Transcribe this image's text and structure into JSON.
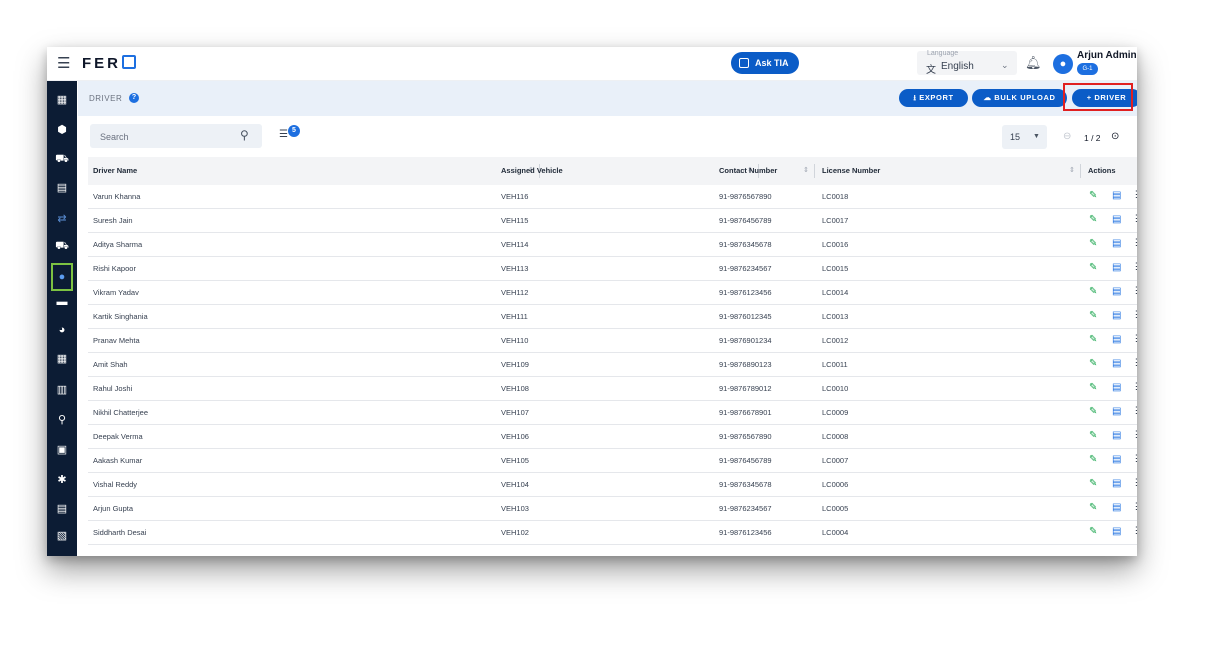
{
  "topbar": {
    "logo_text": "FER",
    "ask_label": "Ask TIA",
    "language_caption": "Language",
    "language_value": "English",
    "user_name": "Arjun Admin",
    "user_badge": "G-1"
  },
  "sidebar": {
    "items": [
      {
        "icon": "dashboard-icon",
        "glyph": "▦"
      },
      {
        "icon": "package-icon",
        "glyph": "⬢"
      },
      {
        "icon": "fleet-icon",
        "glyph": "⛟"
      },
      {
        "icon": "ticket-icon",
        "glyph": "▤"
      },
      {
        "icon": "truck-transfer-icon",
        "glyph": "⇄"
      },
      {
        "icon": "truck-icon",
        "glyph": "⛟"
      },
      {
        "icon": "driver-icon",
        "glyph": "●"
      },
      {
        "icon": "chat-icon",
        "glyph": "▬"
      },
      {
        "icon": "user-voice-icon",
        "glyph": "◕"
      },
      {
        "icon": "sheet-icon",
        "glyph": "▦"
      },
      {
        "icon": "building-icon",
        "glyph": "▥"
      },
      {
        "icon": "route-icon",
        "glyph": "⚲"
      },
      {
        "icon": "inventory-icon",
        "glyph": "▣"
      },
      {
        "icon": "settings-icon",
        "glyph": "✱"
      },
      {
        "icon": "report-icon",
        "glyph": "▤"
      },
      {
        "icon": "archive-icon",
        "glyph": "▧"
      }
    ]
  },
  "header": {
    "title": "DRIVER",
    "export_label": "⭳ EXPORT",
    "bulk_upload_label": "☁ BULK UPLOAD",
    "add_driver_label": "+ DRIVER"
  },
  "toolbar": {
    "search_placeholder": "Search",
    "filter_count": "5",
    "per_page": "15",
    "pagination": "1 / 2"
  },
  "table": {
    "columns": [
      "Driver Name",
      "Assigned Vehicle",
      "Contact Number",
      "License Number",
      "Actions"
    ],
    "rows": [
      [
        "Varun Khanna",
        "VEH116",
        "91-9876567890",
        "LC0018"
      ],
      [
        "Suresh Jain",
        "VEH115",
        "91-9876456789",
        "LC0017"
      ],
      [
        "Aditya Sharma",
        "VEH114",
        "91-9876345678",
        "LC0016"
      ],
      [
        "Rishi Kapoor",
        "VEH113",
        "91-9876234567",
        "LC0015"
      ],
      [
        "Vikram Yadav",
        "VEH112",
        "91-9876123456",
        "LC0014"
      ],
      [
        "Kartik Singhania",
        "VEH111",
        "91-9876012345",
        "LC0013"
      ],
      [
        "Pranav Mehta",
        "VEH110",
        "91-9876901234",
        "LC0012"
      ],
      [
        "Amit Shah",
        "VEH109",
        "91-9876890123",
        "LC0011"
      ],
      [
        "Rahul Joshi",
        "VEH108",
        "91-9876789012",
        "LC0010"
      ],
      [
        "Nikhil Chatterjee",
        "VEH107",
        "91-9876678901",
        "LC0009"
      ],
      [
        "Deepak Verma",
        "VEH106",
        "91-9876567890",
        "LC0008"
      ],
      [
        "Aakash Kumar",
        "VEH105",
        "91-9876456789",
        "LC0007"
      ],
      [
        "Vishal Reddy",
        "VEH104",
        "91-9876345678",
        "LC0006"
      ],
      [
        "Arjun Gupta",
        "VEH103",
        "91-9876234567",
        "LC0005"
      ],
      [
        "Siddharth Desai",
        "VEH102",
        "91-9876123456",
        "LC0004"
      ]
    ]
  },
  "colors": {
    "primary": "#0b5cc7",
    "sidebar": "#0c1c34",
    "edit": "#16a34a",
    "highlight": "#e02020",
    "active_outline": "#7cc242"
  }
}
